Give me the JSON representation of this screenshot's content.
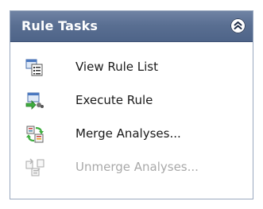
{
  "panel": {
    "title": "Rule Tasks",
    "collapse_icon": "double-chevron-up-icon"
  },
  "tasks": [
    {
      "label": "View Rule List",
      "icon": "rule-list-icon",
      "enabled": true
    },
    {
      "label": "Execute Rule",
      "icon": "execute-rule-icon",
      "enabled": true
    },
    {
      "label": "Merge Analyses...",
      "icon": "merge-analyses-icon",
      "enabled": true
    },
    {
      "label": "Unmerge Analyses...",
      "icon": "unmerge-analyses-icon",
      "enabled": false
    }
  ],
  "colors": {
    "header_top": "#6f83a4",
    "header_bottom": "#4e6488",
    "border": "#9aa9bf",
    "disabled_text": "#a9a9a9"
  }
}
